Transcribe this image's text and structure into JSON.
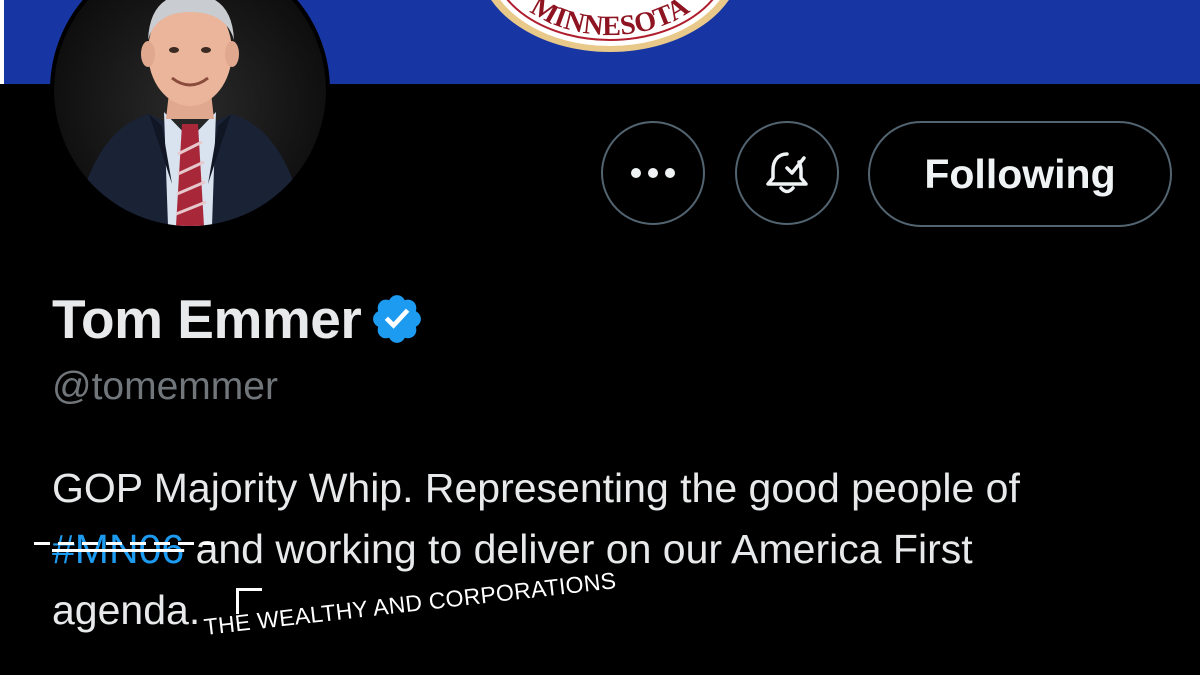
{
  "banner": {
    "seal_text": "MINNESOTA",
    "background_color": "#1836a3"
  },
  "profile": {
    "display_name": "Tom Emmer",
    "handle": "@tomemmer",
    "verified": true,
    "verified_icon": "verified-badge-icon",
    "bio": {
      "line1": "GOP Majority Whip. Representing the good people of",
      "hashtag": "#MN06",
      "line2_rest": " and working to deliver on our America First",
      "line3": "agenda."
    }
  },
  "actions": {
    "more_icon": "more-options-icon",
    "notify_icon": "notification-bell-icon",
    "following_label": "Following"
  },
  "annotation": {
    "text": "THE WEALTHY AND CORPORATIONS"
  },
  "colors": {
    "background": "#000000",
    "text_primary": "#e7e9ea",
    "text_secondary": "#71767b",
    "link": "#1d9bf0",
    "border": "#536471",
    "verified_blue": "#1d9bf0"
  }
}
